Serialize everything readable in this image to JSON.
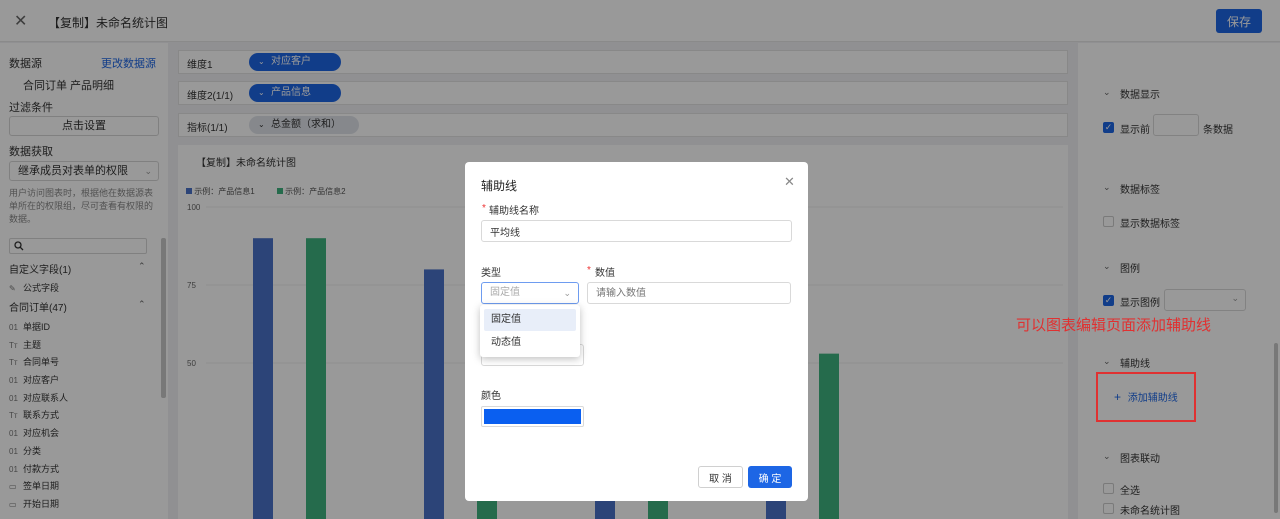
{
  "header": {
    "close_icon": "close-icon",
    "title": "【复制】未命名统计图",
    "save_label": "保存"
  },
  "left": {
    "datasource_label": "数据源",
    "change_datasource": "更改数据源",
    "datasource_value": "合同订单  产品明细",
    "filter_label": "过滤条件",
    "filter_button": "点击设置",
    "fetch_label": "数据获取",
    "fetch_select": "继承成员对表单的权限",
    "hint": "用户访问图表时，根据他在数据源表单所在的权限组，尽可查看有权限的数据。",
    "custom_fields": "自定义字段(1)",
    "formula_field": "公式字段",
    "contract_group": "合同订单(47)",
    "fields": [
      {
        "icon": "01",
        "label": "单据ID"
      },
      {
        "icon": "Tт",
        "label": "主题"
      },
      {
        "icon": "Tт",
        "label": "合同单号"
      },
      {
        "icon": "01",
        "label": "对应客户"
      },
      {
        "icon": "01",
        "label": "对应联系人"
      },
      {
        "icon": "Tт",
        "label": "联系方式"
      },
      {
        "icon": "01",
        "label": "对应机会"
      },
      {
        "icon": "01",
        "label": "分类"
      },
      {
        "icon": "01",
        "label": "付款方式"
      },
      {
        "icon": "▭",
        "label": "签单日期"
      },
      {
        "icon": "▭",
        "label": "开始日期"
      }
    ]
  },
  "rows": {
    "dim1_label": "维度1",
    "dim1_pill": "对应客户",
    "dim2_label": "维度2(1/1)",
    "dim2_pill": "产品信息",
    "metric_label": "指标(1/1)",
    "metric_pill": "总金额（求和）"
  },
  "chart_data": {
    "type": "bar",
    "title": "【复制】未命名统计图",
    "series": [
      {
        "name": "示例：产品信息1",
        "color": "#4a72c9",
        "values": [
          90,
          80,
          30,
          45
        ]
      },
      {
        "name": "示例：产品信息2",
        "color": "#3fb27f",
        "values": [
          90,
          10,
          10,
          53
        ]
      }
    ],
    "ylim": [
      0,
      100
    ],
    "yticks": [
      "100",
      "75",
      "50"
    ]
  },
  "right": {
    "data_display": "数据显示",
    "show_top": "显示前",
    "items_suffix": "条数据",
    "data_label": "数据标签",
    "show_data_label": "显示数据标签",
    "legend": "图例",
    "show_legend": "显示图例",
    "aux_line": "辅助线",
    "add_aux_line": "添加辅助线",
    "chart_link": "图表联动",
    "select_all": "全选",
    "unnamed_chart": "未命名统计图"
  },
  "modal": {
    "title": "辅助线",
    "name_label": "辅助线名称",
    "name_value": "平均线",
    "type_label": "类型",
    "type_placeholder": "固定值",
    "value_label": "数值",
    "value_placeholder": "请输入数值",
    "dropdown_options": [
      "固定值",
      "动态值"
    ],
    "color_label": "颜色",
    "color_value": "#0a5ff0",
    "cancel": "取 消",
    "confirm": "确 定"
  },
  "annotation": {
    "text": "可以图表编辑页面添加辅助线"
  }
}
